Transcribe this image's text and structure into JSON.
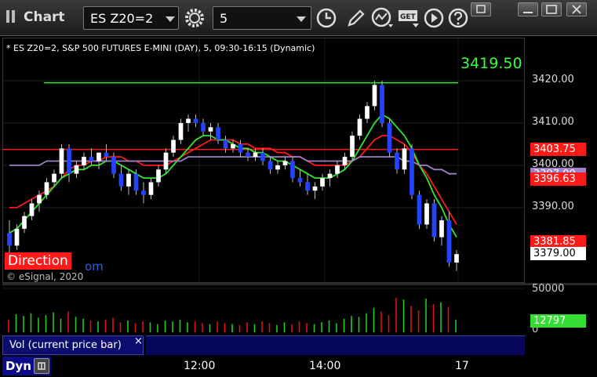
{
  "window": {
    "title": "Chart",
    "symbol": "ES Z20=2",
    "interval": "5"
  },
  "chart_data": {
    "type": "candlestick",
    "title": "* ES Z20=2, S&P 500 FUTURES E-MINI (DAY), 5, 09:30-16:15 (Dynamic)",
    "x_labels": [
      "12:00",
      "14:00",
      "17"
    ],
    "y_ticks": [
      3420,
      3410,
      3400,
      3390
    ],
    "ylim": [
      3372,
      3430
    ],
    "high_line": 3419.5,
    "high_label": "3419.50",
    "price_tags": [
      {
        "label": "3403.75",
        "value": 3403.75,
        "bg": "#ff1a1a",
        "fg": "#ffffff"
      },
      {
        "label": "3397.00",
        "value": 3397.8,
        "bg": "#a080c8",
        "fg": "#ffffff"
      },
      {
        "label": "3396.63",
        "value": 3396.63,
        "bg": "#ff1a1a",
        "fg": "#ffffff"
      },
      {
        "label": "3381.85",
        "value": 3381.85,
        "bg": "#ff1a1a",
        "fg": "#ffffff"
      },
      {
        "label": "3379.00",
        "value": 3379.0,
        "bg": "#ffffff",
        "fg": "#000000"
      }
    ],
    "candles": [
      [
        3384,
        3387,
        3379,
        3381
      ],
      [
        3381,
        3386,
        3380,
        3385
      ],
      [
        3385,
        3389,
        3384,
        3388
      ],
      [
        3388,
        3392,
        3387,
        3391
      ],
      [
        3391,
        3394,
        3389,
        3393
      ],
      [
        3393,
        3397,
        3392,
        3396
      ],
      [
        3396,
        3399,
        3395,
        3398
      ],
      [
        3398,
        3405,
        3397,
        3404
      ],
      [
        3404,
        3405,
        3396,
        3398
      ],
      [
        3398,
        3401,
        3397,
        3400
      ],
      [
        3400,
        3403,
        3399,
        3402
      ],
      [
        3402,
        3404,
        3400,
        3401
      ],
      [
        3401,
        3403,
        3399,
        3403
      ],
      [
        3403,
        3405,
        3401,
        3402
      ],
      [
        3402,
        3403,
        3397,
        3398
      ],
      [
        3398,
        3400,
        3394,
        3395
      ],
      [
        3395,
        3399,
        3393,
        3398
      ],
      [
        3398,
        3399,
        3393,
        3394
      ],
      [
        3394,
        3396,
        3391,
        3393
      ],
      [
        3393,
        3397,
        3392,
        3396
      ],
      [
        3396,
        3400,
        3395,
        3399
      ],
      [
        3399,
        3404,
        3398,
        3403
      ],
      [
        3403,
        3407,
        3402,
        3406
      ],
      [
        3406,
        3411,
        3405,
        3410
      ],
      [
        3410,
        3412,
        3408,
        3411
      ],
      [
        3411,
        3412,
        3409,
        3410
      ],
      [
        3410,
        3411,
        3407,
        3408
      ],
      [
        3408,
        3410,
        3406,
        3409
      ],
      [
        3409,
        3410,
        3405,
        3406
      ],
      [
        3406,
        3407,
        3403,
        3404
      ],
      [
        3404,
        3406,
        3403,
        3405
      ],
      [
        3405,
        3406,
        3402,
        3403
      ],
      [
        3403,
        3404,
        3401,
        3402
      ],
      [
        3402,
        3404,
        3401,
        3403
      ],
      [
        3403,
        3404,
        3400,
        3401
      ],
      [
        3401,
        3402,
        3398,
        3399
      ],
      [
        3399,
        3401,
        3398,
        3400
      ],
      [
        3400,
        3402,
        3399,
        3401
      ],
      [
        3401,
        3402,
        3396,
        3397
      ],
      [
        3397,
        3399,
        3395,
        3396
      ],
      [
        3396,
        3398,
        3393,
        3394
      ],
      [
        3394,
        3396,
        3392,
        3395
      ],
      [
        3395,
        3398,
        3394,
        3397
      ],
      [
        3397,
        3399,
        3395,
        3398
      ],
      [
        3398,
        3401,
        3397,
        3400
      ],
      [
        3400,
        3403,
        3399,
        3402
      ],
      [
        3402,
        3408,
        3401,
        3407
      ],
      [
        3407,
        3412,
        3406,
        3411
      ],
      [
        3411,
        3415,
        3410,
        3414
      ],
      [
        3414,
        3420,
        3413,
        3419
      ],
      [
        3419,
        3420,
        3409,
        3410
      ],
      [
        3410,
        3411,
        3402,
        3403
      ],
      [
        3403,
        3404,
        3398,
        3399
      ],
      [
        3399,
        3405,
        3398,
        3404
      ],
      [
        3404,
        3405,
        3392,
        3393
      ],
      [
        3393,
        3394,
        3385,
        3386
      ],
      [
        3386,
        3392,
        3385,
        3391
      ],
      [
        3391,
        3392,
        3382,
        3383
      ],
      [
        3383,
        3388,
        3381,
        3387
      ],
      [
        3387,
        3389,
        3376,
        3377
      ],
      [
        3377,
        3380,
        3375,
        3379
      ]
    ],
    "indicators": [
      {
        "color": "#ff1a1a",
        "values": [
          3390,
          3390,
          3391,
          3392,
          3393,
          3394,
          3395,
          3397,
          3399,
          3400,
          3400,
          3401,
          3401,
          3402,
          3402,
          3402,
          3401,
          3401,
          3400,
          3400,
          3400,
          3400,
          3401,
          3402,
          3403,
          3404,
          3405,
          3406,
          3406,
          3406,
          3406,
          3405,
          3405,
          3404,
          3404,
          3404,
          3403,
          3403,
          3402,
          3402,
          3401,
          3400,
          3400,
          3400,
          3400,
          3400,
          3401,
          3402,
          3404,
          3406,
          3407,
          3407,
          3406,
          3405,
          3403,
          3400,
          3398,
          3395,
          3392,
          3389,
          3386
        ]
      },
      {
        "color": "#2ee82e",
        "values": [
          3384,
          3385,
          3387,
          3389,
          3391,
          3393,
          3395,
          3397,
          3398,
          3399,
          3399,
          3400,
          3400,
          3401,
          3401,
          3400,
          3399,
          3398,
          3397,
          3397,
          3397,
          3398,
          3400,
          3402,
          3404,
          3406,
          3407,
          3407,
          3406,
          3406,
          3405,
          3404,
          3404,
          3403,
          3403,
          3402,
          3401,
          3401,
          3400,
          3399,
          3398,
          3397,
          3397,
          3397,
          3398,
          3399,
          3401,
          3404,
          3407,
          3410,
          3412,
          3411,
          3409,
          3407,
          3404,
          3400,
          3397,
          3393,
          3390,
          3386,
          3383
        ]
      },
      {
        "color": "#a080c8",
        "values": [
          3400,
          3400,
          3400,
          3400,
          3400,
          3401,
          3401,
          3401,
          3401,
          3401,
          3401,
          3401,
          3401,
          3401,
          3401,
          3401,
          3401,
          3401,
          3401,
          3401,
          3401,
          3401,
          3401,
          3401,
          3402,
          3402,
          3402,
          3402,
          3402,
          3402,
          3402,
          3402,
          3402,
          3402,
          3402,
          3402,
          3402,
          3402,
          3402,
          3402,
          3401,
          3401,
          3401,
          3401,
          3401,
          3401,
          3401,
          3402,
          3402,
          3402,
          3402,
          3402,
          3402,
          3401,
          3401,
          3400,
          3400,
          3399,
          3399,
          3398,
          3398
        ]
      }
    ],
    "volume": {
      "ticks": [
        "50000",
        "0"
      ],
      "ymax": 50000,
      "current_label": "12797",
      "current_value": 12797,
      "values": [
        14000,
        20000,
        18000,
        21000,
        16000,
        19000,
        22000,
        15000,
        23000,
        17000,
        15000,
        13000,
        12000,
        14000,
        16000,
        11000,
        13000,
        10000,
        12000,
        11000,
        9000,
        13000,
        12000,
        14000,
        11000,
        12000,
        10000,
        9000,
        12000,
        10000,
        9000,
        8000,
        11000,
        9000,
        12000,
        10000,
        8000,
        11000,
        9000,
        12000,
        10000,
        9000,
        11000,
        13000,
        10000,
        15000,
        18000,
        17000,
        21000,
        27000,
        23000,
        19000,
        38000,
        36000,
        29000,
        24000,
        37000,
        31000,
        33000,
        28000,
        14000
      ]
    }
  },
  "overlay": {
    "direction": "Direction",
    "direction_tail": "om",
    "copyright": "© eSignal, 2020"
  },
  "bottom": {
    "study_tab": "Vol (current price bar)",
    "close_glyph": "×",
    "dyn_label": "Dyn"
  },
  "icons": [
    "settings-gear-icon",
    "clock-icon",
    "pencil-icon",
    "indicator-icon",
    "get-icon",
    "play-icon",
    "restore-icon",
    "minimize-icon",
    "maximize-icon",
    "close-icon"
  ]
}
